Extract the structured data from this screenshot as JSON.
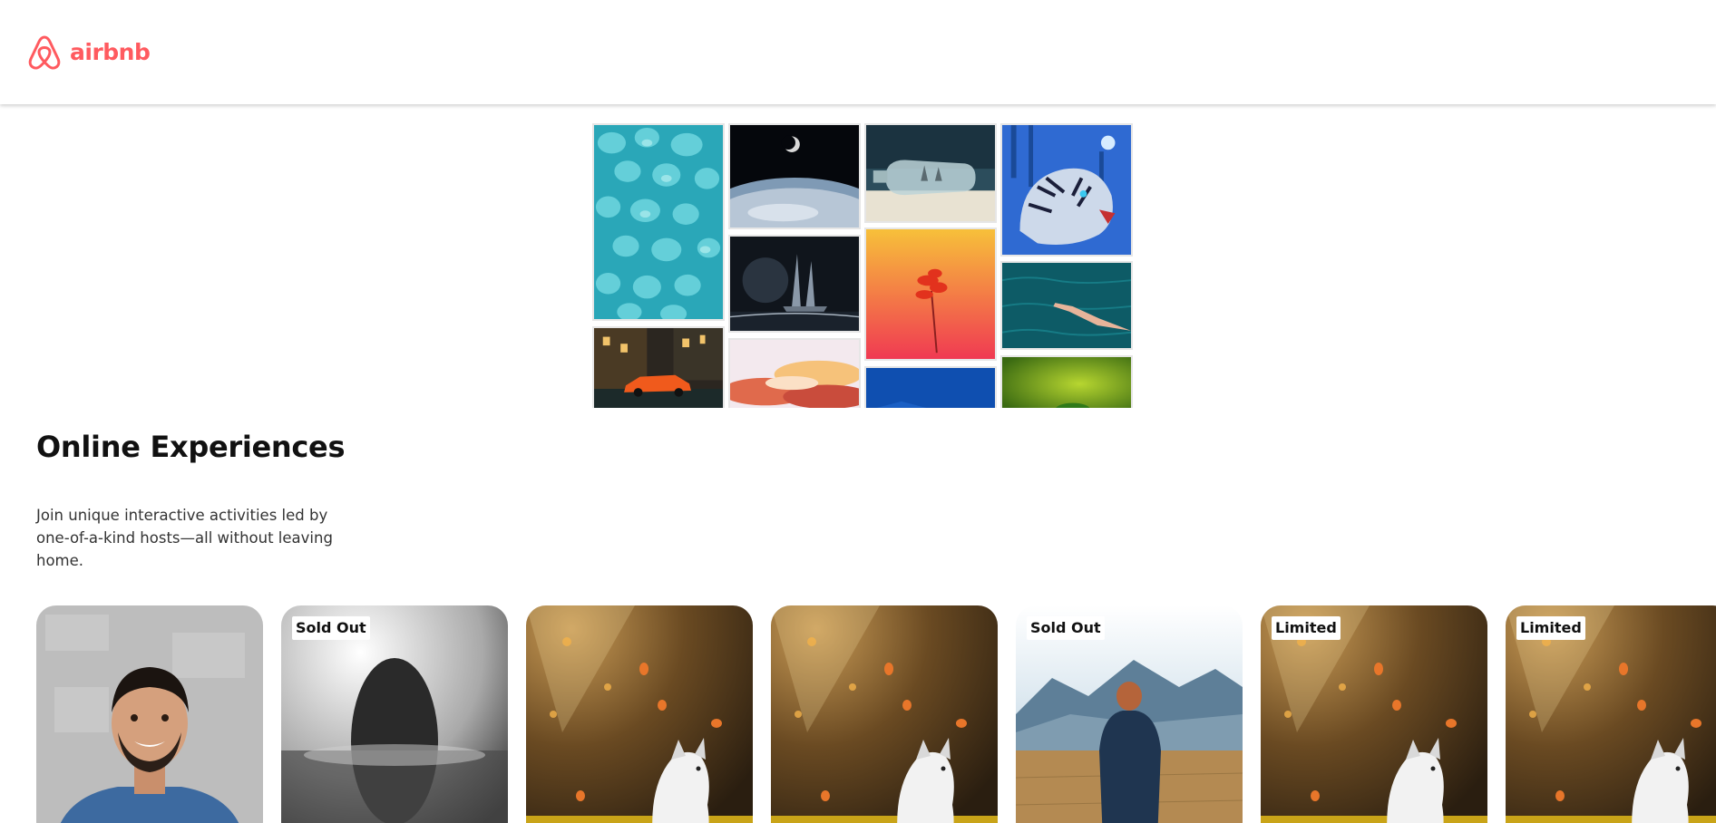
{
  "navbar": {
    "brand_name": "airbnb",
    "logo_icon": "airbnb-belo-icon",
    "brand_color": "#ff5a5f"
  },
  "hero": {
    "tiles": [
      "blue-crystals",
      "earth-moon-space",
      "ship-in-bottle",
      "blue-tiger",
      "ghost-ship-night",
      "red-flower-orange",
      "hand-in-water",
      "orange-sports-car",
      "sunset-clouds",
      "blue-sky",
      "green-leaf"
    ]
  },
  "section": {
    "title": "Online Experiences",
    "description": "Join unique interactive activities led by one-of-a-kind hosts—all without leaving home."
  },
  "cards": [
    {
      "image": "smiling-man-portrait",
      "badge": ""
    },
    {
      "image": "dark-portal-fog",
      "badge": "Sold Out"
    },
    {
      "image": "dog-autumn-leaves",
      "badge": ""
    },
    {
      "image": "dog-autumn-leaves",
      "badge": ""
    },
    {
      "image": "man-mountain-field",
      "badge": "Sold Out"
    },
    {
      "image": "dog-autumn-leaves",
      "badge": "Limited"
    },
    {
      "image": "dog-autumn-leaves",
      "badge": "Limited"
    }
  ]
}
